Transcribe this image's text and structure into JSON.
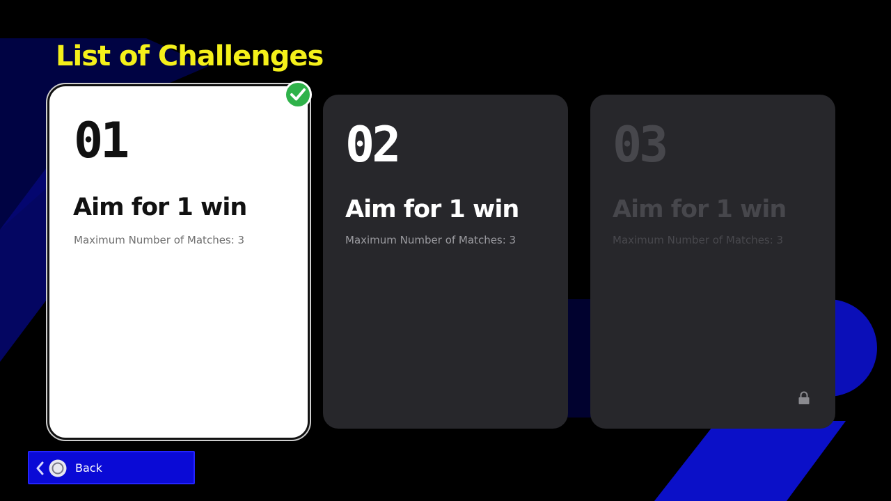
{
  "header": {
    "title": "List of Challenges"
  },
  "challenges": [
    {
      "number": "01",
      "title": "Aim for 1 win",
      "subtitle": "Maximum Number of Matches: 3",
      "state": "completed",
      "icon": "check-icon"
    },
    {
      "number": "02",
      "title": "Aim for 1 win",
      "subtitle": "Maximum Number of Matches: 3",
      "state": "available"
    },
    {
      "number": "03",
      "title": "Aim for 1 win",
      "subtitle": "Maximum Number of Matches: 3",
      "state": "locked",
      "icon": "lock-icon"
    }
  ],
  "footer": {
    "back_label": "Back",
    "back_icons": [
      "chevron-left-icon",
      "circle-button-icon"
    ]
  },
  "colors": {
    "title": "#f4f01a",
    "accent_blue": "#0a0ad6",
    "card_dark": "#27272b",
    "check_green": "#2fb24a"
  }
}
